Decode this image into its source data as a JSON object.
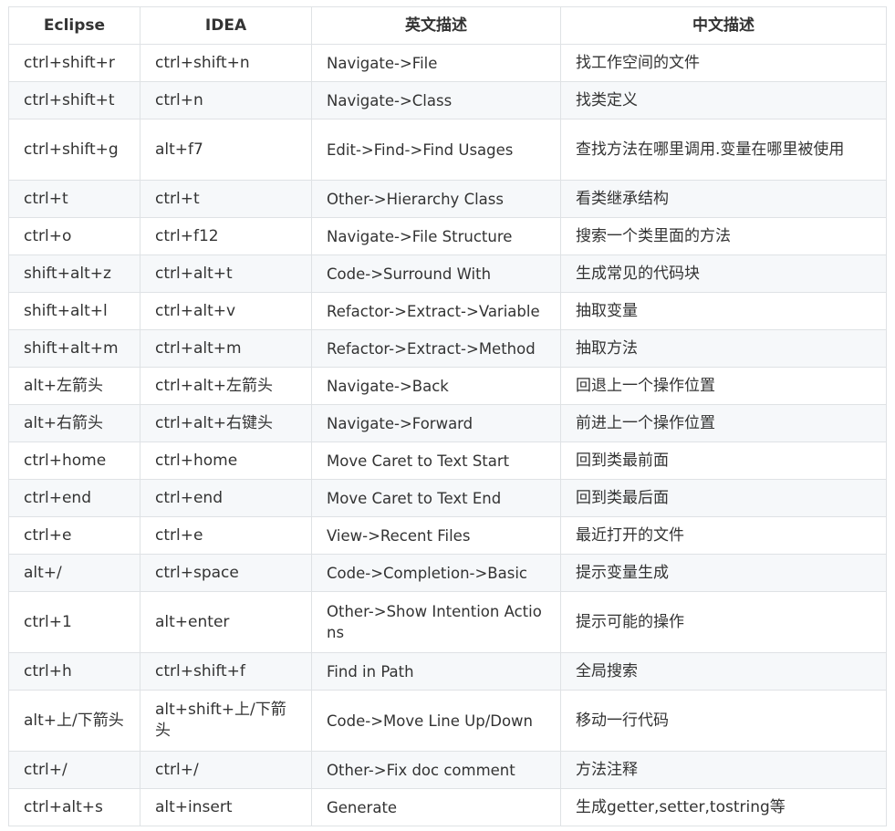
{
  "table": {
    "headers": [
      "Eclipse",
      "IDEA",
      "英文描述",
      "中文描述"
    ],
    "rows": [
      [
        "ctrl+shift+r",
        "ctrl+shift+n",
        "Navigate->File",
        "找工作空间的文件"
      ],
      [
        "ctrl+shift+t",
        "ctrl+n",
        "Navigate->Class",
        "找类定义"
      ],
      [
        "ctrl+shift+g",
        "alt+f7",
        "Edit->Find->Find Usages",
        "查找方法在哪里调用.变量在哪里被使用"
      ],
      [
        "ctrl+t",
        "ctrl+t",
        "Other->Hierarchy Class",
        "看类继承结构"
      ],
      [
        "ctrl+o",
        "ctrl+f12",
        "Navigate->File Structure",
        "搜索一个类里面的方法"
      ],
      [
        "shift+alt+z",
        "ctrl+alt+t",
        "Code->Surround With",
        "生成常见的代码块"
      ],
      [
        "shift+alt+l",
        "ctrl+alt+v",
        "Refactor->Extract->Variable",
        "抽取变量"
      ],
      [
        "shift+alt+m",
        "ctrl+alt+m",
        "Refactor->Extract->Method",
        "抽取方法"
      ],
      [
        "alt+左箭头",
        "ctrl+alt+左箭头",
        "Navigate->Back",
        "回退上一个操作位置"
      ],
      [
        "alt+右箭头",
        "ctrl+alt+右键头",
        "Navigate->Forward",
        "前进上一个操作位置"
      ],
      [
        "ctrl+home",
        "ctrl+home",
        "Move Caret to Text Start",
        "回到类最前面"
      ],
      [
        "ctrl+end",
        "ctrl+end",
        "Move Caret to Text End",
        "回到类最后面"
      ],
      [
        "ctrl+e",
        "ctrl+e",
        "View->Recent Files",
        "最近打开的文件"
      ],
      [
        "alt+/",
        "ctrl+space",
        "Code->Completion->Basic",
        "提示变量生成"
      ],
      [
        "ctrl+1",
        "alt+enter",
        "Other->Show Intention Actions",
        "提示可能的操作"
      ],
      [
        "ctrl+h",
        "ctrl+shift+f",
        "Find in Path",
        "全局搜索"
      ],
      [
        "alt+上/下箭头",
        "alt+shift+上/下箭头",
        "Code->Move Line Up/Down",
        "移动一行代码"
      ],
      [
        "ctrl+/",
        "ctrl+/",
        "Other->Fix doc comment",
        "方法注释"
      ],
      [
        "ctrl+alt+s",
        "alt+insert",
        "Generate",
        "生成getter,setter,tostring等"
      ]
    ]
  }
}
